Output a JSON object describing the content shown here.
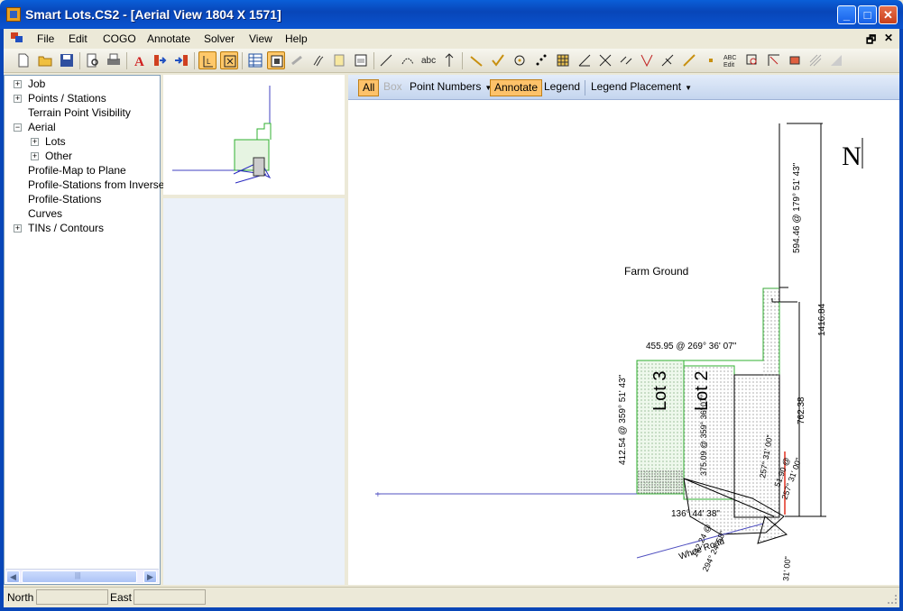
{
  "window": {
    "title": "Smart Lots.CS2 - [Aerial View   1804  X  1571]",
    "min_label": "_",
    "max_label": "□",
    "close_label": "✕"
  },
  "menu": {
    "items": [
      "File",
      "Edit",
      "COGO",
      "Annotate",
      "Solver",
      "View",
      "Help"
    ],
    "restore_label": "🗗",
    "close_label": "✕"
  },
  "tree": {
    "nodes": [
      "Job",
      "Points / Stations",
      "Terrain Point Visibility",
      "Aerial",
      "Lots",
      "Other",
      "Profile-Map to Plane",
      "Profile-Stations from Inverse",
      "Profile-Stations",
      "Curves",
      "TINs / Contours"
    ],
    "scroll_mid": "|||"
  },
  "mapbar": {
    "all": "All",
    "box": "Box",
    "point_numbers": "Point Numbers",
    "annotate": "Annotate",
    "legend": "Legend",
    "legend_placement": "Legend Placement"
  },
  "map": {
    "north": "N",
    "farm_ground": "Farm Ground",
    "lot3": "Lot 3",
    "lot2": "Lot 2",
    "dim_top": "455.95 @  269° 36' 07\"",
    "dim_right_vert": "594.46 @  179° 51' 43\"",
    "dim_total": "1416.84",
    "dim_762": "762.38",
    "dim_left": "412.54 @  359° 51' 43\"",
    "dim_lot2": "375.09 @ 359° 36' 07\"",
    "dim_angle": "136° 44' 38\"",
    "dim_road_bearing": "257° 31' 00\"",
    "dim_road_small": "51.90 @",
    "dim_road_small2": "257° 31' 00\"",
    "dim_road_lower": "31' 00\"",
    "dim_road_rot": "294° 24' 58\"",
    "dim_road_num": "142.24 @",
    "road": "Whee   Road"
  },
  "status": {
    "north": "North",
    "east": "East"
  }
}
